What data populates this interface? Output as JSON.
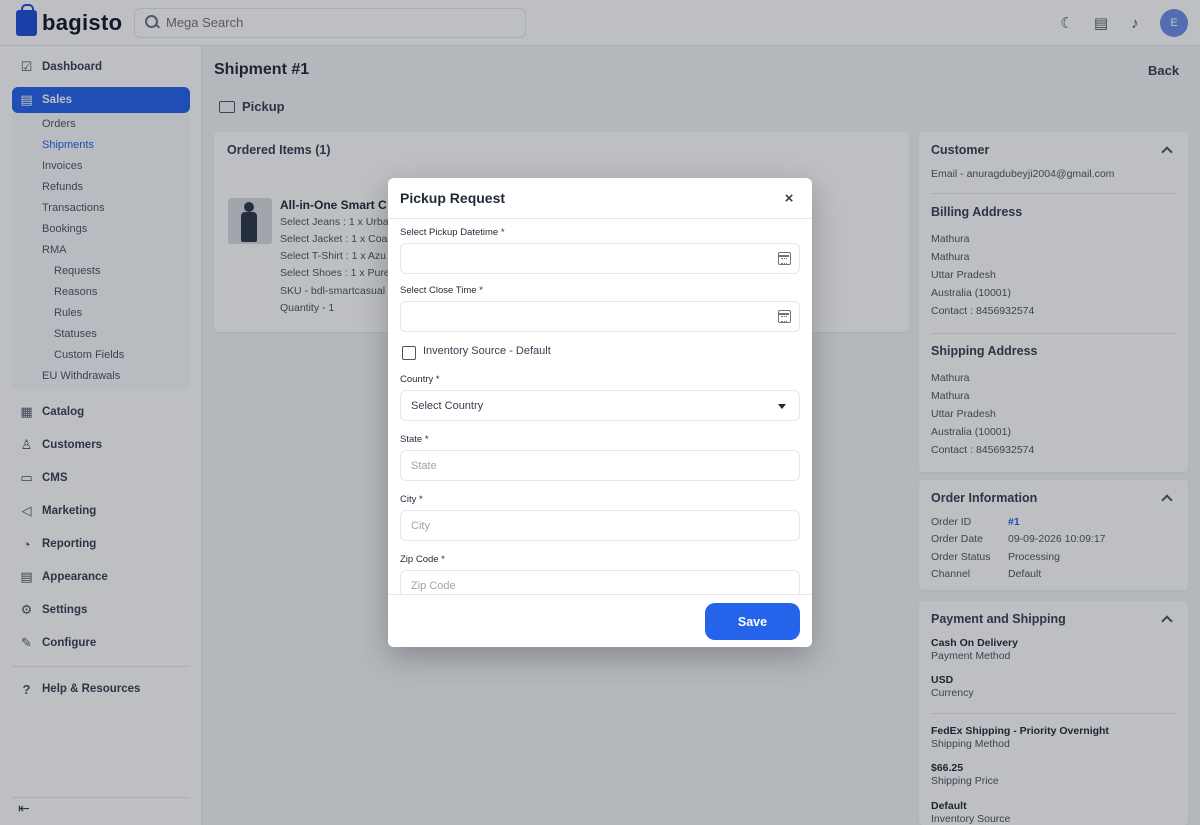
{
  "app": {
    "logo_text": "bagisto"
  },
  "search": {
    "placeholder": "Mega Search"
  },
  "header": {
    "avatar_initial": "E"
  },
  "sidebar": {
    "items": [
      {
        "label": "Dashboard",
        "icon": "dashboard-icon"
      },
      {
        "label": "Sales",
        "icon": "sales-icon",
        "active": true
      },
      {
        "label": "Catalog",
        "icon": "catalog-icon"
      },
      {
        "label": "Customers",
        "icon": "customers-icon"
      },
      {
        "label": "CMS",
        "icon": "cms-icon"
      },
      {
        "label": "Marketing",
        "icon": "marketing-icon"
      },
      {
        "label": "Reporting",
        "icon": "reporting-icon"
      },
      {
        "label": "Appearance",
        "icon": "appearance-icon"
      },
      {
        "label": "Settings",
        "icon": "settings-icon"
      },
      {
        "label": "Configure",
        "icon": "configure-icon"
      },
      {
        "label": "Help & Resources",
        "icon": "help-icon"
      }
    ],
    "sales_sub": [
      "Orders",
      "Shipments",
      "Invoices",
      "Refunds",
      "Transactions",
      "Bookings",
      "RMA"
    ],
    "rma_sub": [
      "Requests",
      "Reasons",
      "Rules",
      "Statuses",
      "Custom Fields"
    ],
    "eu_withdrawals": "EU Withdrawals",
    "active_sub": "Shipments"
  },
  "page": {
    "title": "Shipment #1",
    "back_label": "Back",
    "pickup_label": "Pickup"
  },
  "ordered_items": {
    "title": "Ordered Items (1)",
    "item": {
      "name": "All-in-One Smart C",
      "lines": [
        "Select Jeans : 1 x Urba",
        "Select Jacket : 1 x Coas",
        "Select T-Shirt : 1 x Azu",
        "Select Shoes : 1 x Pure",
        "SKU - bdl-smartcasual",
        "Quantity - 1"
      ]
    }
  },
  "customer": {
    "title": "Customer",
    "email": "Email - anuragdubeyji2004@gmail.com",
    "billing_title": "Billing Address",
    "billing": [
      "Mathura",
      "Mathura",
      "Uttar Pradesh",
      "Australia (10001)",
      "Contact : 8456932574"
    ],
    "shipping_title": "Shipping Address",
    "shipping": [
      "Mathura",
      "Mathura",
      "Uttar Pradesh",
      "Australia (10001)",
      "Contact : 8456932574"
    ]
  },
  "order_info": {
    "title": "Order Information",
    "rows": [
      {
        "key": "Order ID",
        "value": "#1"
      },
      {
        "key": "Order Date",
        "value": "09-09-2026 10:09:17"
      },
      {
        "key": "Order Status",
        "value": "Processing"
      },
      {
        "key": "Channel",
        "value": "Default"
      }
    ]
  },
  "payment": {
    "title": "Payment and Shipping",
    "blocks": [
      {
        "value": "Cash On Delivery",
        "label": "Payment Method"
      },
      {
        "value": "USD",
        "label": "Currency"
      },
      {
        "value": "FedEx Shipping - Priority Overnight",
        "label": "Shipping Method"
      },
      {
        "value": "$66.25",
        "label": "Shipping Price"
      },
      {
        "value": "Default",
        "label": "Inventory Source"
      }
    ]
  },
  "modal": {
    "title": "Pickup Request",
    "close_symbol": "×",
    "pickup_datetime_label": "Select Pickup Datetime *",
    "pickup_datetime_value": "",
    "close_time_label": "Select Close Time *",
    "close_time_value": "",
    "inventory_label": "Inventory Source - Default",
    "country_label": "Country *",
    "country_value": "Select Country",
    "state_label": "State *",
    "state_placeholder": "State",
    "city_label": "City *",
    "city_placeholder": "City",
    "zip_label": "Zip Code *",
    "zip_placeholder": "Zip Code",
    "save_label": "Save"
  }
}
